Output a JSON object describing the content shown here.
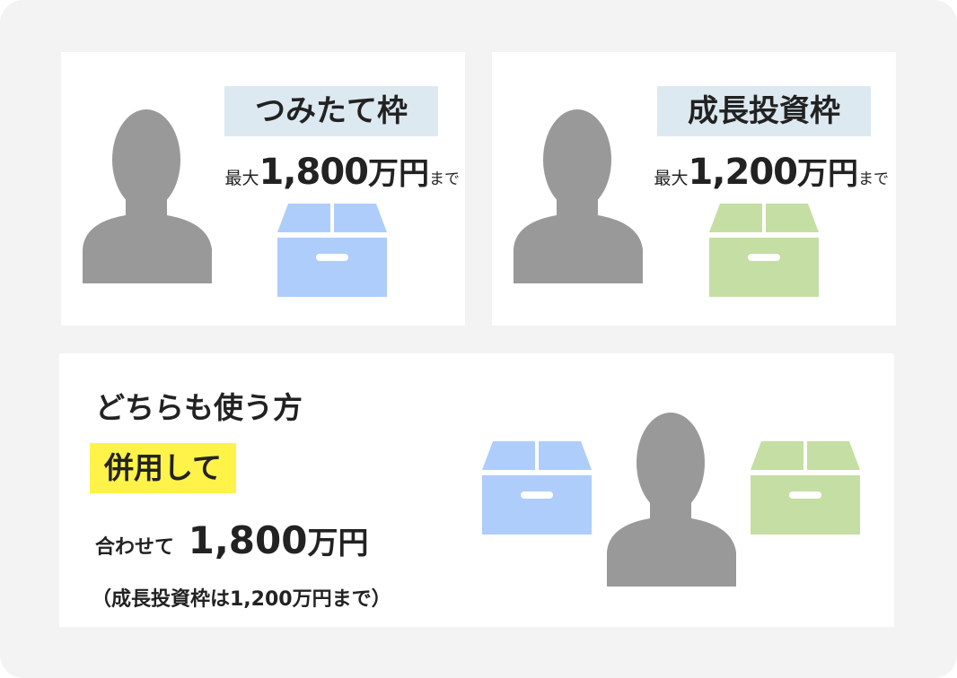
{
  "tsumitate": {
    "tag": "つみたて枠",
    "limit_prefix": "最大",
    "limit_value": "1,800",
    "limit_unit": "万円",
    "limit_suffix": "まで"
  },
  "growth": {
    "tag": "成長投資枠",
    "limit_prefix": "最大",
    "limit_value": "1,200",
    "limit_unit": "万円",
    "limit_suffix": "まで"
  },
  "combined": {
    "heading": "どちらも使う方",
    "highlight": "併用して",
    "total_prefix": "合わせて",
    "total_value": "1,800",
    "total_unit": "万円",
    "note": "（成長投資枠は1,200万円まで）"
  },
  "colors": {
    "frame_bg": "#f3f3f3",
    "card_bg": "#ffffff",
    "person": "#999999",
    "tag_bg": "#dde9f1",
    "highlight_bg": "#fff34a",
    "box_blue": "#aecdfb",
    "box_green": "#c5dea4"
  },
  "icons": {
    "person": "person-silhouette-icon",
    "box_blue": "blue-box-icon",
    "box_green": "green-box-icon"
  }
}
